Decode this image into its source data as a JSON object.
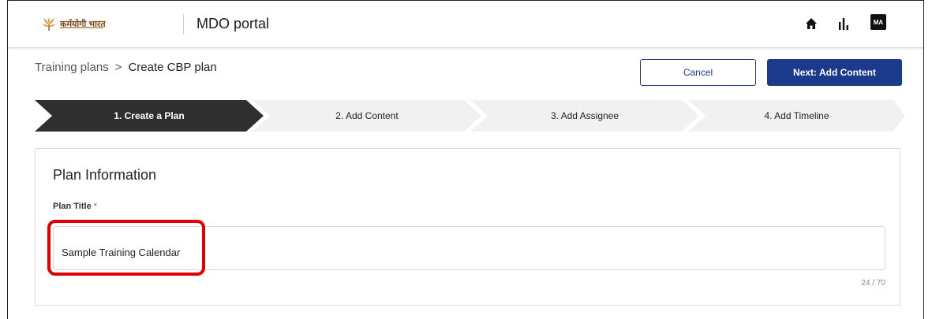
{
  "header": {
    "logo_text": "कर्मयोगी भारत",
    "portal_name": "MDO portal",
    "avatar_initials": "MA",
    "icons": [
      "home-icon",
      "bar-chart-icon"
    ]
  },
  "breadcrumb": {
    "parent": "Training plans",
    "separator": ">",
    "current": "Create CBP plan"
  },
  "actions": {
    "cancel_label": "Cancel",
    "next_label": "Next: Add Content"
  },
  "steps": [
    {
      "label": "1. Create a Plan",
      "active": true
    },
    {
      "label": "2. Add Content",
      "active": false
    },
    {
      "label": "3. Add Assignee",
      "active": false
    },
    {
      "label": "4. Add Timeline",
      "active": false
    }
  ],
  "form": {
    "section_title": "Plan Information",
    "plan_title_label": "Plan Title",
    "required_marker": "*",
    "plan_title_value": "Sample Training Calendar",
    "char_counter": "24 / 70"
  },
  "colors": {
    "primary": "#1b3a8c",
    "step_active": "#2f2f2f",
    "step_inactive": "#f1f1f1",
    "highlight": "#e00000"
  }
}
